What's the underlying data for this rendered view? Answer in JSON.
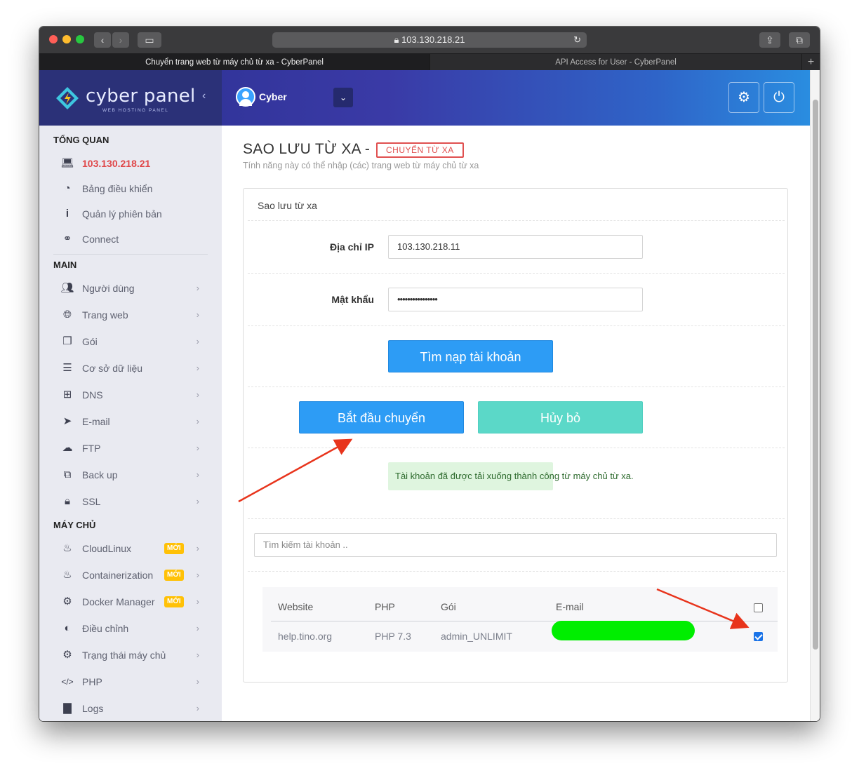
{
  "browser": {
    "url": "103.130.218.21",
    "tabs": [
      {
        "label": "Chuyển trang web từ máy chủ từ xa - CyberPanel",
        "active": true
      },
      {
        "label": "API Access for User - CyberPanel",
        "active": false
      }
    ]
  },
  "header": {
    "logo_text": "cyber panel",
    "logo_sub": "WEB HOSTING PANEL",
    "user_name": "Cyber"
  },
  "sidebar": {
    "sections": [
      {
        "heading": "TỔNG QUAN",
        "items": [
          {
            "label": "103.130.218.21",
            "icon": "laptop-icon"
          },
          {
            "label": "Bảng điều khiển",
            "icon": "dashboard-icon"
          },
          {
            "label": "Quản lý phiên bản",
            "icon": "info-icon"
          },
          {
            "label": "Connect",
            "icon": "link-icon"
          }
        ]
      },
      {
        "heading": "MAIN",
        "items": [
          {
            "label": "Người dùng",
            "icon": "users-icon"
          },
          {
            "label": "Trang web",
            "icon": "globe-icon"
          },
          {
            "label": "Gói",
            "icon": "cubes-icon"
          },
          {
            "label": "Cơ sở dữ liệu",
            "icon": "database-icon"
          },
          {
            "label": "DNS",
            "icon": "sitemap-icon"
          },
          {
            "label": "E-mail",
            "icon": "paper-plane-icon"
          },
          {
            "label": "FTP",
            "icon": "cloud-upload-icon"
          },
          {
            "label": "Back up",
            "icon": "copy-icon"
          },
          {
            "label": "SSL",
            "icon": "lock-icon"
          }
        ]
      },
      {
        "heading": "MÁY CHỦ",
        "items": [
          {
            "label": "CloudLinux",
            "icon": "flame-icon",
            "badge": "MỚI"
          },
          {
            "label": "Containerization",
            "icon": "flame-icon",
            "badge": "MỚI"
          },
          {
            "label": "Docker Manager",
            "icon": "cogs-icon",
            "badge": "MỚI"
          },
          {
            "label": "Điều chỉnh",
            "icon": "adjust-icon"
          },
          {
            "label": "Trạng thái máy chủ",
            "icon": "gear-icon"
          },
          {
            "label": "PHP",
            "icon": "code-icon"
          },
          {
            "label": "Logs",
            "icon": "file-icon"
          }
        ]
      }
    ]
  },
  "main": {
    "title": "SAO LƯU TỪ XA -",
    "title_badge": "CHUYỂN TỪ XA",
    "subtitle": "Tính năng này có thể nhập (các) trang web từ máy chủ từ xa",
    "panel_title": "Sao lưu từ xa",
    "ip_label": "Địa chỉ IP",
    "ip_value": "103.130.218.11",
    "password_label": "Mật khẩu",
    "password_value": "••••••••••••••••",
    "fetch_button": "Tìm nạp tài khoản",
    "start_button": "Bắt đầu chuyển",
    "cancel_button": "Hủy bỏ",
    "success_message": "Tài khoản đã được tải xuống thành công từ máy chủ từ xa.",
    "search_placeholder": "Tìm kiếm tài khoản ..",
    "table": {
      "headers": [
        "Website",
        "PHP",
        "Gói",
        "E-mail"
      ],
      "rows": [
        {
          "website": "help.tino.org",
          "php": "PHP 7.3",
          "package": "admin_UNLIMIT",
          "email": "",
          "checked": true
        }
      ]
    }
  },
  "colors": {
    "accent_blue": "#2d9cf5",
    "accent_teal": "#5bd8c8",
    "active_red": "#e0484a",
    "badge_yellow": "#ffc107",
    "annotation_arrow": "#e8341c"
  }
}
